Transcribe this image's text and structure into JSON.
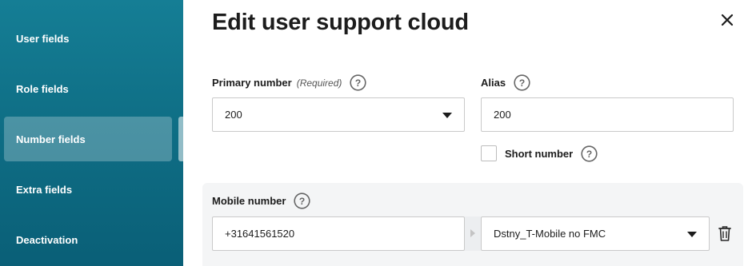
{
  "sidebar": {
    "items": [
      {
        "label": "User fields",
        "active": false
      },
      {
        "label": "Role fields",
        "active": false
      },
      {
        "label": "Number fields",
        "active": true
      },
      {
        "label": "Extra fields",
        "active": false
      },
      {
        "label": "Deactivation",
        "active": false
      }
    ]
  },
  "panel": {
    "title": "Edit user support cloud",
    "close_icon": "close-icon"
  },
  "primary_number": {
    "label": "Primary number",
    "required_text": "(Required)",
    "value": "200",
    "help_icon": "help-icon"
  },
  "alias": {
    "label": "Alias",
    "value": "200",
    "help_icon": "help-icon"
  },
  "short_number": {
    "label": "Short number",
    "checked": false,
    "help_icon": "help-icon"
  },
  "mobile_number": {
    "label": "Mobile number",
    "value": "+31641561520",
    "provider": "Dstny_T-Mobile no FMC",
    "help_icon": "help-icon",
    "delete_icon": "trash-icon"
  },
  "colors": {
    "sidebar_top": "#157e95",
    "sidebar_bottom": "#0a5f77",
    "text_dark": "#1c1c1c",
    "section_bg": "#f4f5f6"
  }
}
